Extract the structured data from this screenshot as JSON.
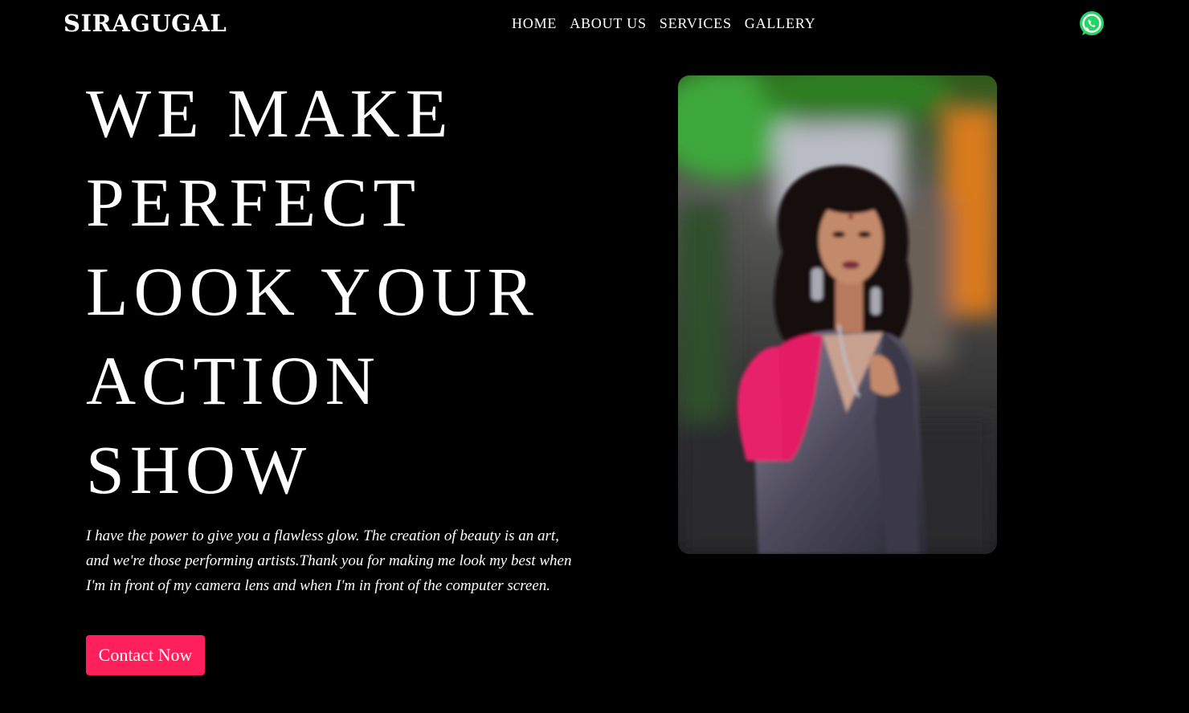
{
  "header": {
    "logo": "SIRAGUGAL",
    "nav": [
      "HOME",
      "ABOUT US",
      "SERVICES",
      "GALLERY"
    ],
    "whatsapp_icon": "whatsapp-icon"
  },
  "hero": {
    "headline_lines": [
      "WE MAKE",
      "PERFECT",
      "LOOK YOUR",
      "ACTION",
      "SHOW"
    ],
    "description": "I have the power to give you a flawless glow. The creation of beauty is an art, and we're those performing artists.Thank you for making me look my best when I'm in front of my camera lens and when I'm in front of the computer screen.",
    "cta_label": "Contact Now",
    "image_alt": "model-portrait"
  },
  "colors": {
    "background": "#000000",
    "accent": "#ff1f5a",
    "whatsapp": "#25d366"
  }
}
